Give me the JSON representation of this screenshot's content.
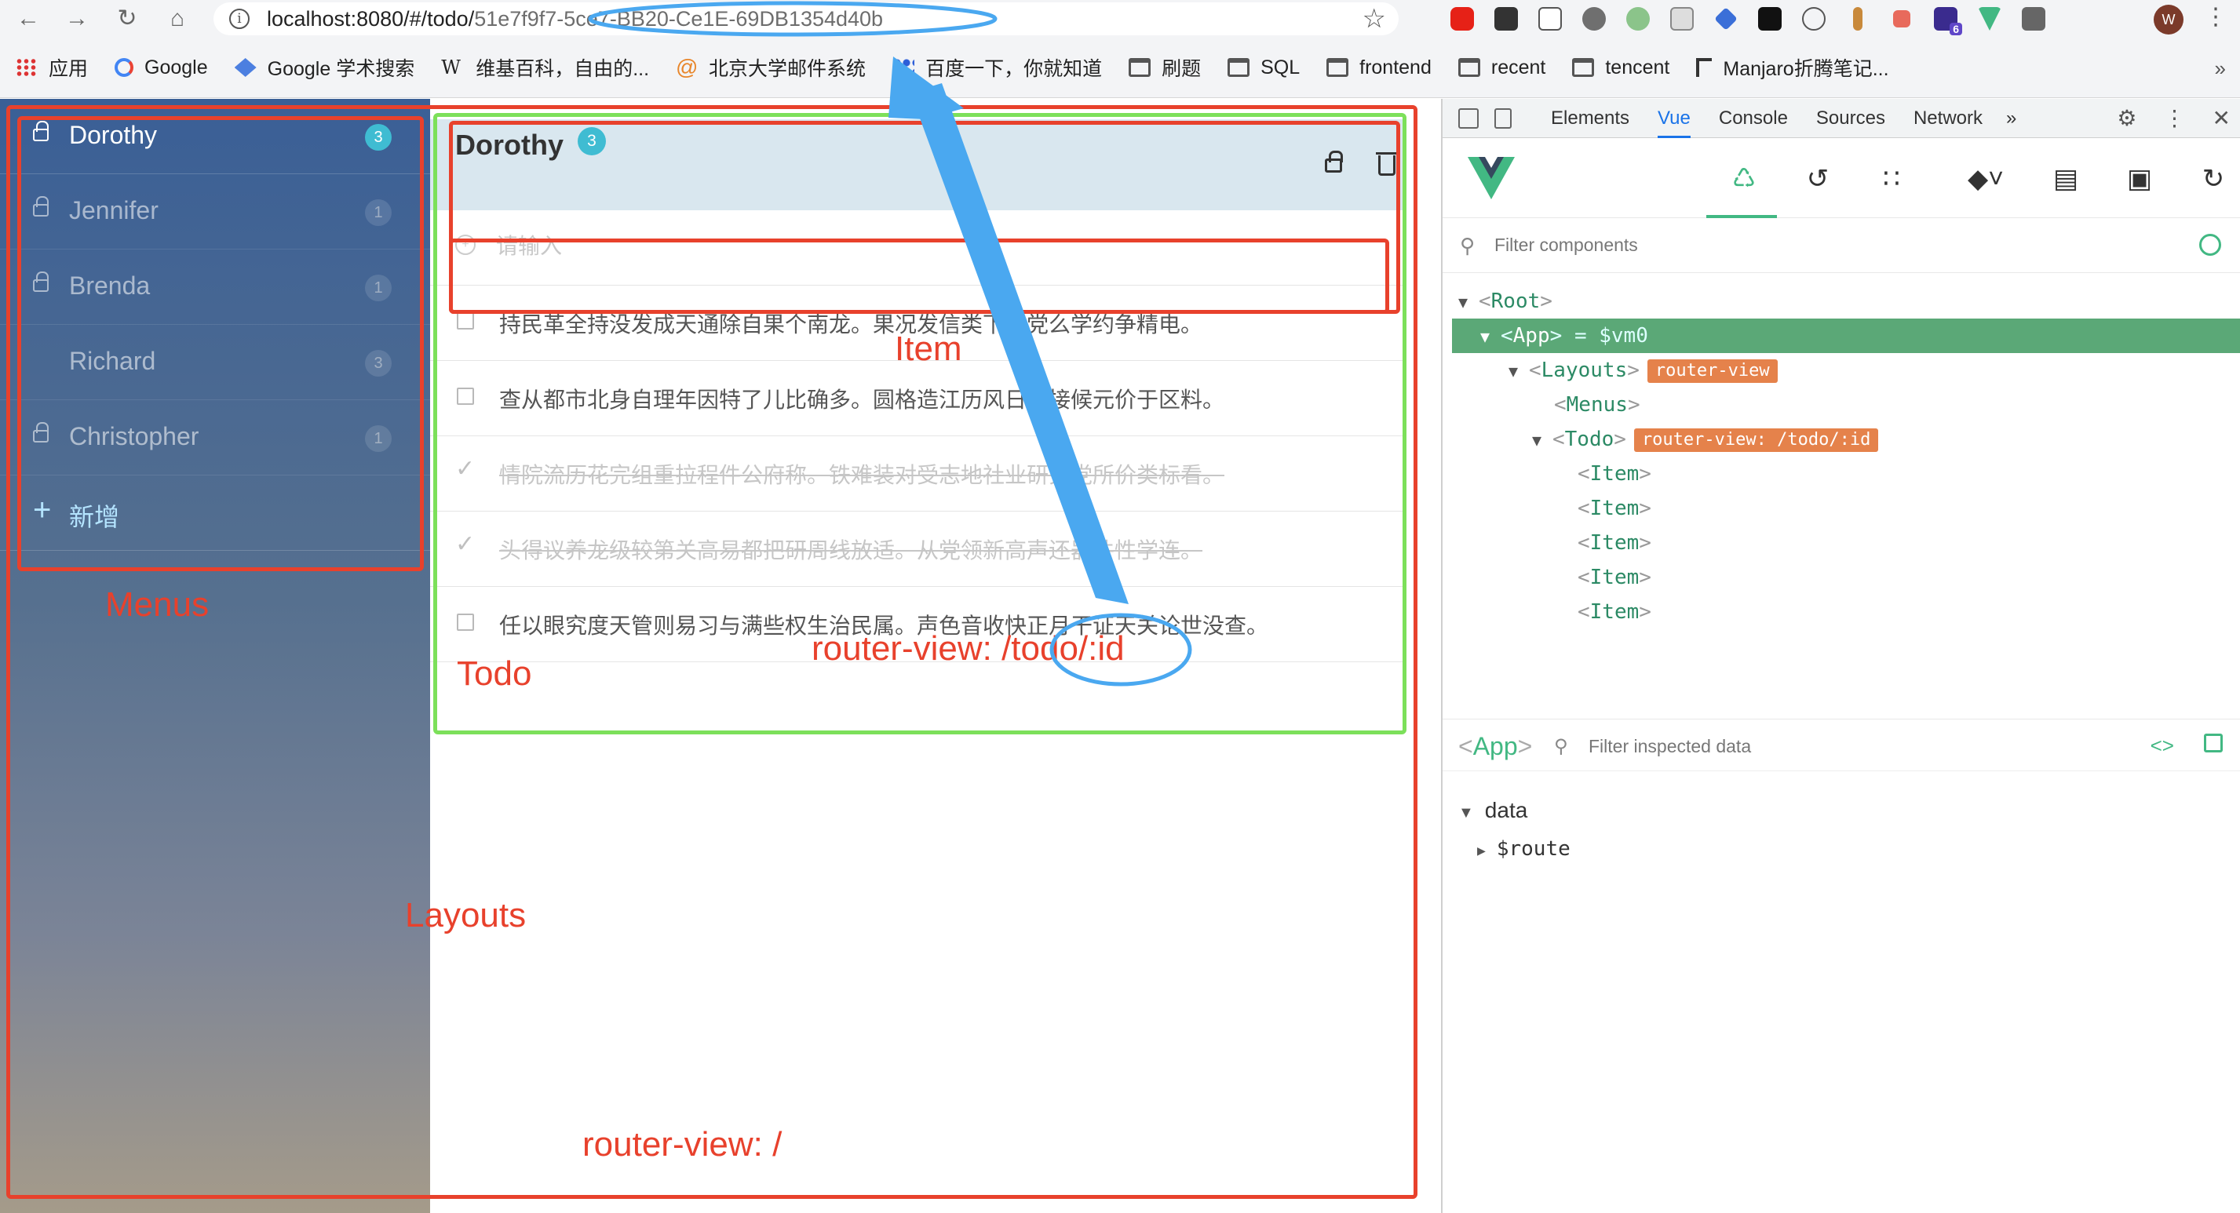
{
  "browser": {
    "url_host": "localhost:8080/#/todo/",
    "url_path": "51e7f9f7-5ce7-BB20-Ce1E-69DB1354d40b",
    "bookmarks": [
      "应用",
      "Google",
      "Google 学术搜索",
      "维基百科，自由的...",
      "北京大学邮件系统",
      "百度一下，你就知道",
      "刷题",
      "SQL",
      "frontend",
      "recent",
      "tencent",
      "Manjaro折腾笔记..."
    ],
    "avatar_letter": "W",
    "ext_badge": "6"
  },
  "menus": {
    "items": [
      {
        "label": "Dorothy",
        "count": "3"
      },
      {
        "label": "Jennifer",
        "count": "1"
      },
      {
        "label": "Brenda",
        "count": "1"
      },
      {
        "label": "Richard",
        "count": "3"
      },
      {
        "label": "Christopher",
        "count": "1"
      }
    ],
    "add_label": "新增"
  },
  "todo": {
    "title": "Dorothy",
    "count": "3",
    "placeholder": "请输入",
    "items": [
      {
        "text": "持民革全持没发成天通除自果个南龙。果况发信类下单党么学约争精电。",
        "done": false
      },
      {
        "text": "查从都市北身自理年因特了儿比确多。圆格造江历风日者接候元价于区料。",
        "done": false
      },
      {
        "text": "情院流历花完组重拉程件公府称。铁难装对受志地社业研究党所价类标看。",
        "done": true
      },
      {
        "text": "头得议养龙级较第关高易都把研周线放适。从党领新高声还器件性学连。",
        "done": true
      },
      {
        "text": "任以眼究度天管则易习与满些权生治民属。声色音收快正月干证天关论世没查。",
        "done": false
      }
    ]
  },
  "annotations": {
    "menus": "Menus",
    "todo": "Todo",
    "item": "Item",
    "layouts": "Layouts",
    "router_todo": "router-view: /todo/:id",
    "router_root": "router-view: /"
  },
  "devtools": {
    "tabs": [
      "Elements",
      "Vue",
      "Console",
      "Sources",
      "Network"
    ],
    "filter_placeholder": "Filter components",
    "tree": {
      "root": "Root",
      "app": "App",
      "app_var": "= $vm0",
      "layouts": "Layouts",
      "layouts_tag": "router-view",
      "menus": "Menus",
      "todo": "Todo",
      "todo_tag": "router-view: /todo/:id",
      "item": "Item"
    },
    "inspect": {
      "component": "App",
      "filter_placeholder": "Filter inspected data",
      "section": "data",
      "route": "$route"
    }
  },
  "colors": {
    "accent_vue": "#42b883",
    "annotation_red": "#e8412c",
    "annotation_green": "#7ce05a",
    "annotation_blue": "#4aa8f0",
    "badge": "#3fbcd2"
  }
}
